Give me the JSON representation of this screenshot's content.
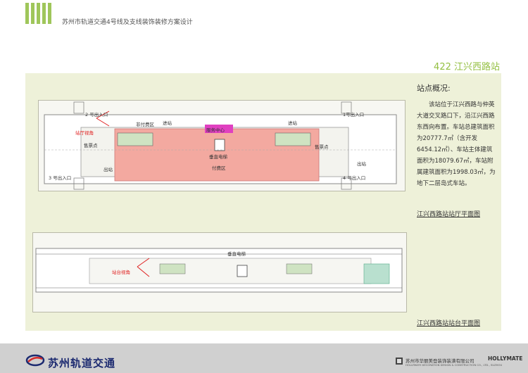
{
  "header": {
    "document_title": "苏州市轨道交通4号线及支线装饰装修方案设计",
    "station_title": "422 江兴西路站"
  },
  "overview": {
    "heading": "站点概况:",
    "text": "该站位于江兴西路与仲英大道交叉路口下，沿江兴西路东西向布置。车站总建筑面积为20777.7㎡（含开发6454.12㎡）、车站主体建筑面积为18079.67㎡，车站附属建筑面积为1998.03㎡，为地下二层岛式车站。"
  },
  "concourse_plan": {
    "caption": "江兴西路站站厅平面图",
    "labels": {
      "entrance_2": "2 号出入口",
      "entrance_1": "1号出入口",
      "entrance_3": "3 号出入口",
      "entrance_4": "4 号出入口",
      "view_angle": "站厅视角",
      "unpaid_area": "非付费区",
      "paid_area": "付费区",
      "ticket_left": "售票点",
      "ticket_right": "售票点",
      "enter_left": "进站",
      "enter_right": "进站",
      "exit_left": "出站",
      "exit_right": "出站",
      "service_center": "服务中心",
      "elevator": "垂直电梯"
    }
  },
  "platform_plan": {
    "caption": "江兴西路站站台平面图",
    "labels": {
      "view_angle": "站台视角",
      "elevator": "垂直电梯"
    }
  },
  "footer": {
    "logo_text": "苏州轨道交通",
    "company_cn": "苏州市华丽美登装饰装潢有限公司",
    "company_en": "HOLLYMATE DECORATION DESIGN & CONSTRUCTION CO., LTD., SUZHOU",
    "brand": "HOLLYMATE"
  },
  "colors": {
    "accent_green": "#93bf40",
    "paid_area_pink": "#f3a9a0",
    "service_magenta": "#e040c0",
    "view_red": "#e02020",
    "logo_blue": "#1c2a70"
  }
}
